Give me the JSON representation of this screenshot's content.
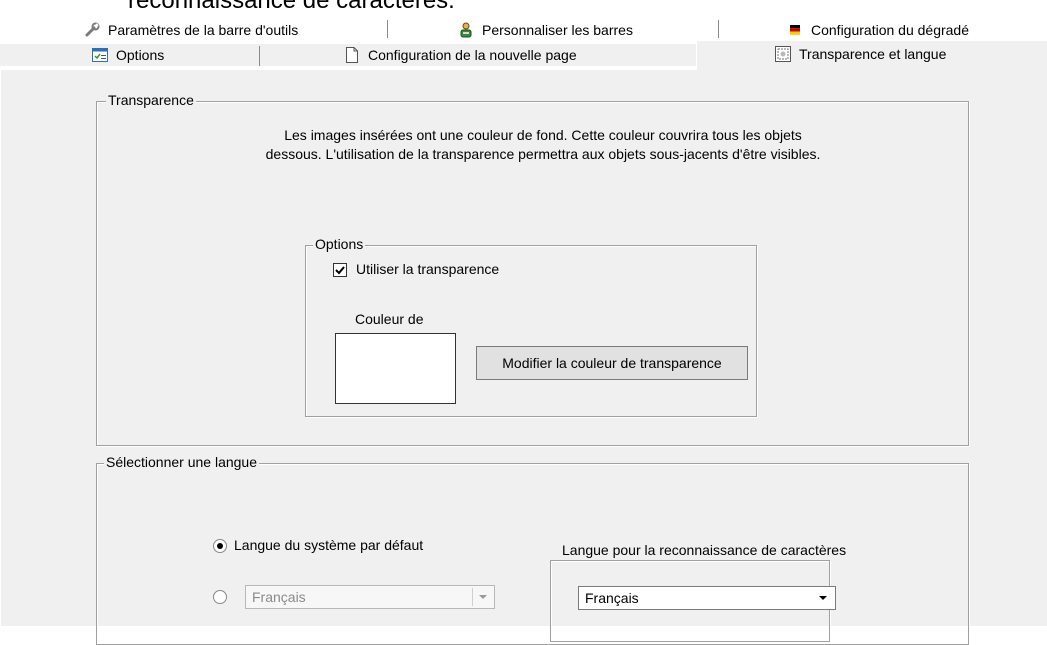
{
  "window": {
    "cut_heading": "reconnaissance de caractères."
  },
  "tabs": {
    "row1": [
      {
        "label": "Paramètres de la barre d'outils",
        "icon": "wrench-icon"
      },
      {
        "label": "Personnaliser les barres",
        "icon": "person-tools-icon"
      },
      {
        "label": "Configuration du dégradé",
        "icon": "gradient-flag-icon"
      }
    ],
    "row2": [
      {
        "label": "Options",
        "icon": "options-window-icon"
      },
      {
        "label": "Configuration de la nouvelle page",
        "icon": "new-page-icon"
      },
      {
        "label": "Transparence et langue",
        "icon": "transparency-icon",
        "active": true
      }
    ]
  },
  "transparency": {
    "group_title": "Transparence",
    "description": "Les images insérées ont une couleur de fond. Cette couleur couvrira tous les objets dessous. L'utilisation de la transparence permettra aux objets sous-jacents d'être visibles.",
    "options_title": "Options",
    "use_transparency_label": "Utiliser la transparence",
    "use_transparency_checked": true,
    "color_label": "Couleur de",
    "swatch_color": "#ffffff",
    "change_color_button": "Modifier la couleur de transparence"
  },
  "language": {
    "group_title": "Sélectionner une langue",
    "system_default_label": "Langue du système par défaut",
    "system_default_selected": true,
    "custom_language_value": "Français",
    "ocr_group_title": "Langue pour la reconnaissance de caractères",
    "ocr_language_value": "Français"
  }
}
